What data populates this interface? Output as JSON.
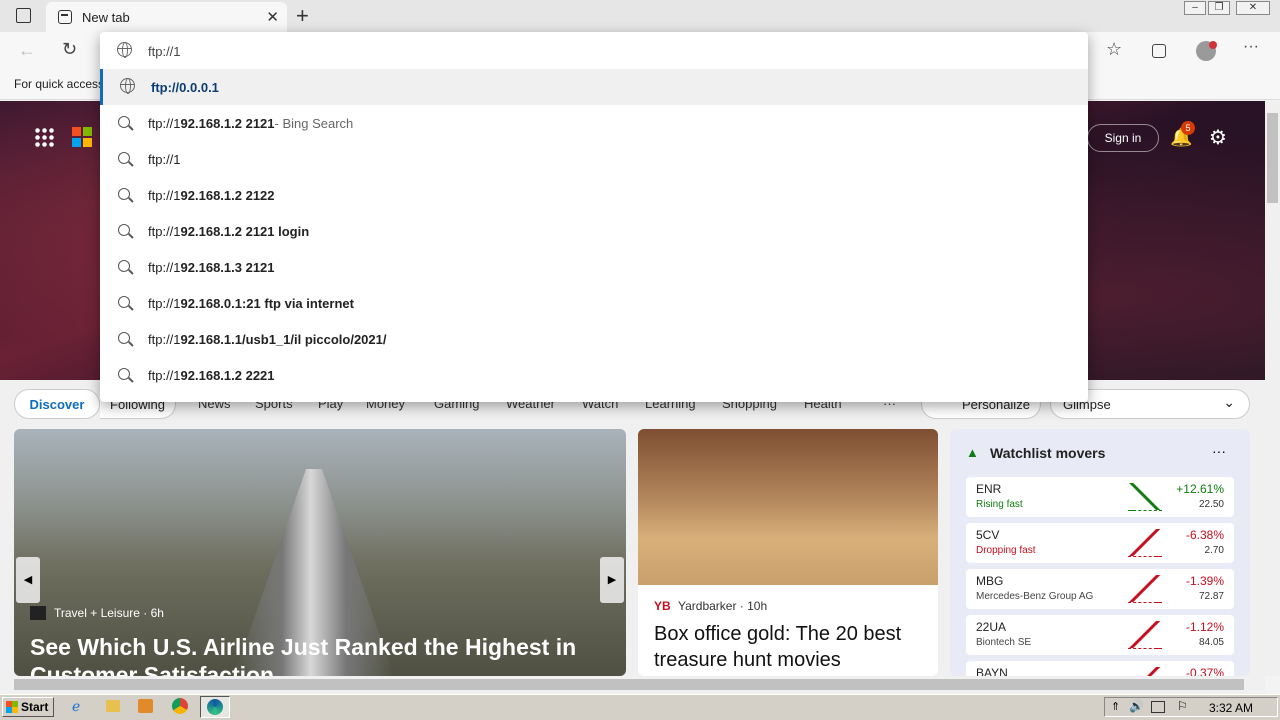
{
  "browser": {
    "tab_title": "New tab",
    "favorites_text": "For quick access",
    "address_value": "ftp://1"
  },
  "omnibox": {
    "suggestions": [
      {
        "prefix": "",
        "bold": "ftp://0.0.0.1",
        "suffix": "",
        "icon": "globe-icon"
      },
      {
        "prefix": "ftp://1",
        "bold": "92.168.1.2 2121",
        "suffix": " - Bing Search",
        "icon": "search-icon"
      },
      {
        "prefix": "ftp://1",
        "bold": "",
        "suffix": "",
        "icon": "search-icon"
      },
      {
        "prefix": "ftp://1",
        "bold": "92.168.1.2 2122",
        "suffix": "",
        "icon": "search-icon"
      },
      {
        "prefix": "ftp://1",
        "bold": "92.168.1.2 2121 login",
        "suffix": "",
        "icon": "search-icon"
      },
      {
        "prefix": "ftp://1",
        "bold": "92.168.1.3 2121",
        "suffix": "",
        "icon": "search-icon"
      },
      {
        "prefix": "ftp://1",
        "bold": "92.168.0.1:21 ftp via internet",
        "suffix": "",
        "icon": "search-icon"
      },
      {
        "prefix": "ftp://1",
        "bold": "92.168.1.1/usb1_1/il piccolo/2021/",
        "suffix": "",
        "icon": "search-icon"
      },
      {
        "prefix": "ftp://1",
        "bold": "92.168.1.2 2221",
        "suffix": "",
        "icon": "search-icon"
      }
    ]
  },
  "msn": {
    "sign_in": "Sign in",
    "notification_count": "5",
    "nav": [
      "Discover",
      "Following",
      "News",
      "Sports",
      "Play",
      "Money",
      "Gaming",
      "Weather",
      "Watch",
      "Learning",
      "Shopping",
      "Health",
      "···"
    ],
    "personalize": "Personalize",
    "layout_select": "Glimpse"
  },
  "cards": {
    "main": {
      "source": "Travel + Leisure · 6h",
      "headline": "See Which U.S. Airline Just Ranked the Highest in Customer Satisfaction"
    },
    "second": {
      "source": "Yardbarker · 10h",
      "headline": "Box office gold: The 20 best treasure hunt movies"
    }
  },
  "watchlist": {
    "title": "Watchlist movers",
    "stocks": [
      {
        "ticker": "ENR",
        "sub": "Rising fast",
        "change": "+12.61%",
        "price": "22.50",
        "color": "#107c10"
      },
      {
        "ticker": "5CV",
        "sub": "Dropping fast",
        "change": "-6.38%",
        "price": "2.70",
        "color": "#c50f1f"
      },
      {
        "ticker": "MBG",
        "sub": "Mercedes-Benz Group AG",
        "change": "-1.39%",
        "price": "72.87",
        "color": "#c50f1f"
      },
      {
        "ticker": "22UA",
        "sub": "Biontech SE",
        "change": "-1.12%",
        "price": "84.05",
        "color": "#c50f1f"
      },
      {
        "ticker": "BAYN",
        "sub": "",
        "change": "-0.37%",
        "price": "",
        "color": "#c50f1f"
      }
    ]
  },
  "taskbar": {
    "start": "Start",
    "clock": "3:32 AM"
  }
}
